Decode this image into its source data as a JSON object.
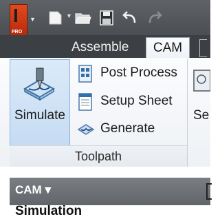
{
  "app": {
    "logo_letter": "I",
    "logo_badge": "PRO"
  },
  "quick_access": {
    "icons": [
      "new-file-icon",
      "open-folder-icon",
      "save-icon",
      "undo-icon",
      "redo-icon"
    ]
  },
  "tabs": [
    {
      "label": "Assemble",
      "active": false
    },
    {
      "label": "CAM",
      "active": true
    }
  ],
  "ribbon": {
    "simulate_label": "Simulate",
    "commands": [
      {
        "label": "Post Process",
        "icon": "post-process-icon"
      },
      {
        "label": "Setup Sheet",
        "icon": "setup-sheet-icon"
      },
      {
        "label": "Generate",
        "icon": "generate-icon"
      }
    ],
    "panel_title": "Toolpath",
    "right_partial_label": "Se"
  },
  "browser": {
    "title": "CAM ▾",
    "node": "Simulation"
  },
  "colors": {
    "accent": "#c6dcf3",
    "app_button": "#d23a14",
    "tab_strip": "#3c3f43"
  }
}
